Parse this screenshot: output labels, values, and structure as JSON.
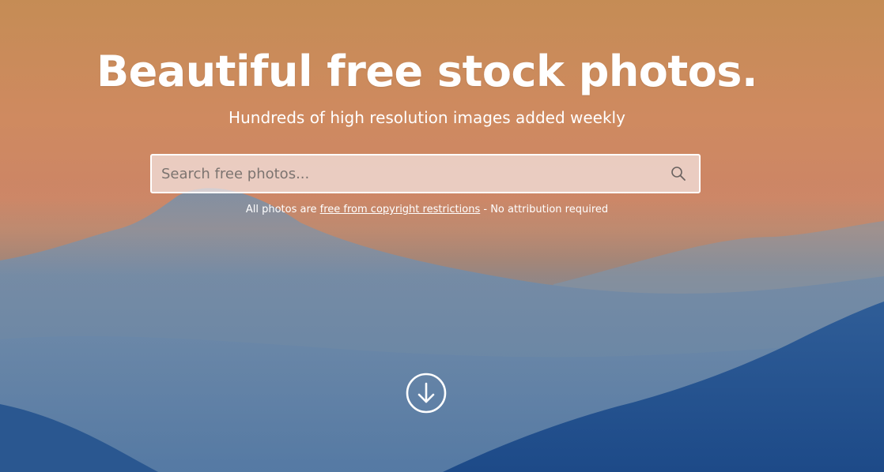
{
  "hero": {
    "title": "Beautiful free stock photos.",
    "subtitle": "Hundreds of high resolution images added weekly"
  },
  "search": {
    "placeholder": "Search free photos...",
    "value": "",
    "icon": "search-icon"
  },
  "notice": {
    "prefix": "All photos are ",
    "link_text": "free from copyright restrictions",
    "suffix": " - No attribution required"
  },
  "scroll": {
    "icon": "arrow-down-circle-icon"
  },
  "colors": {
    "sky_top": "#c98e5c",
    "sky_mid": "#d08664",
    "mountain_far": "#6a86a5",
    "mountain_near": "#1f4f8f",
    "text": "#ffffff"
  }
}
